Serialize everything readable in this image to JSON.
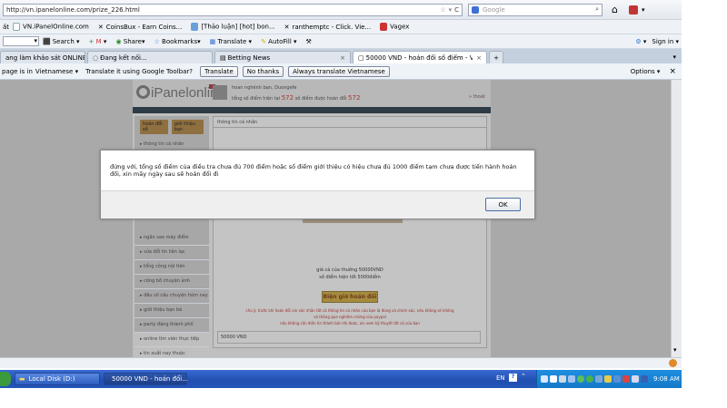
{
  "url": "http://vn.ipanelonline.com/prize_226.html",
  "search_placeholder": "Google",
  "bookmarks": [
    "VN.iPanelOnline.com",
    "CoinsBux - Earn Coins...",
    "[Thảo luận] [hot] bon...",
    "ranthemptc - Click. Vie...",
    "Vagex"
  ],
  "google_toolbar": {
    "search": "Search",
    "share": "Share",
    "bookmarks": "Bookmarks",
    "translate": "Translate",
    "autofill": "AutoFill",
    "signin": "Sign in"
  },
  "tabs": [
    {
      "label": "ang làm khảo sát ONLINE ta...",
      "active": false
    },
    {
      "label": "Đang kết nối...",
      "active": false
    },
    {
      "label": "Betting News",
      "active": false
    },
    {
      "label": "50000 VND - hoán đổi số điểm - VN iPanel...",
      "active": true
    }
  ],
  "translate_bar": {
    "prefix": "page is in",
    "language": "Vietnamese",
    "question": "Translate it using Google Toolbar?",
    "translate": "Translate",
    "no_thanks": "No thanks",
    "always": "Always translate Vietnamese",
    "options": "Options",
    "close": "×"
  },
  "site": {
    "logo": "iPanelonline",
    "welcome": "hoan nghênh bạn, Duongefe",
    "points_prefix": "tổng số điểm hiện tại",
    "points_current": "572",
    "points_mid": "số điểm được hoán đổi",
    "points_available": "572",
    "logout": "» thoát",
    "menu_btn1": "hoán đổi số",
    "menu_btn2": "giới thiệu bạn",
    "content_tab": "thông tin cá nhân",
    "side_top": "thông tin cá nhân",
    "side_items": [
      "ngân sao máy điểm",
      "sửa đổi tin liên lạc",
      "tổng công nội tiên",
      "công bố chuyện ảnh",
      "đầu số câu chuyện hóm nay",
      "giới thiệu bạn bè",
      "party đăng thành phố",
      "online tìm viên thực tiếp",
      "tin xuất nay thuộc"
    ],
    "points_line1": "giá cả của thưởng",
    "points_line1_val": "50000VND",
    "points_line2": "số điểm hiện tốt",
    "points_line2_val": "5000điểm",
    "redeem_button": "Biện giờ hoán đổi",
    "notice1": "chú ý: trước khi hoán đổi xin xác nhận tất cả thông tin cá nhân của bạn là đúng và chính xác, nếu không sẽ không",
    "notice2": "và thông qua nghiệm chứng của paypal",
    "notice3": "nếu không cần điền tin thành bản thì được, xin xem kỹ thuyết tất cả của bạn",
    "footer": "50000 VND"
  },
  "dialog": {
    "message": "đứng với, tổng số điểm của điều tra chưa đủ 700 điểm hoặc số điểm giới thiệu có hiệu chưa đủ 1000 điểm tạm chưa được tiến hành hoán đổi, xin mấy ngày sau sẽ hoán đổi đi",
    "ok": "OK"
  },
  "taskbar": {
    "item1": "Local Disk (D:)",
    "item2": "50000 VND - hoán đổi...",
    "lang": "EN",
    "time": "9:08 AM"
  }
}
